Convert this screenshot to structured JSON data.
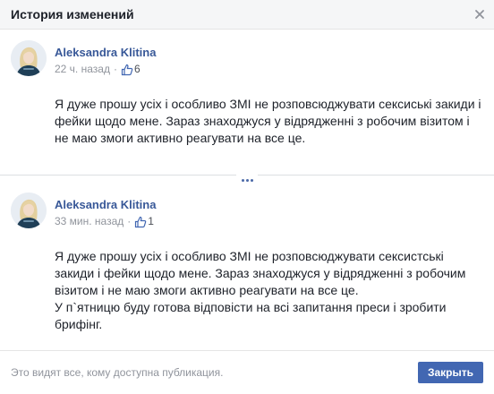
{
  "dialog": {
    "title": "История изменений",
    "close_icon": "close-icon"
  },
  "edits": [
    {
      "author": "Aleksandra Klitina",
      "time": "22 ч. назад",
      "like_count": "6",
      "paragraphs": [
        "Я дуже прошу усіх і особливо ЗМІ не розповсюджувати сексиські закиди і фейки щодо мене. Зараз знаходжуся у відрядженні з робочим візитом і не маю змоги активно реагувати на все це."
      ]
    },
    {
      "author": "Aleksandra Klitina",
      "time": "33 мин. назад",
      "like_count": "1",
      "paragraphs": [
        "Я дуже прошу усіх і особливо ЗМІ не розповсюджувати сексистські закиди і фейки щодо мене. Зараз знаходжуся у відрядженні з робочим візитом і не маю змоги активно реагувати на все це.",
        "У п`ятницю буду готова відповісти на всі запитання преси і зробити брифінг."
      ]
    }
  ],
  "footer": {
    "note": "Это видят все, кому доступна публикация.",
    "close_label": "Закрыть"
  },
  "colors": {
    "link": "#385898",
    "primary_button": "#4267b2",
    "muted_text": "#90949c",
    "header_bg": "#f5f6f7"
  }
}
